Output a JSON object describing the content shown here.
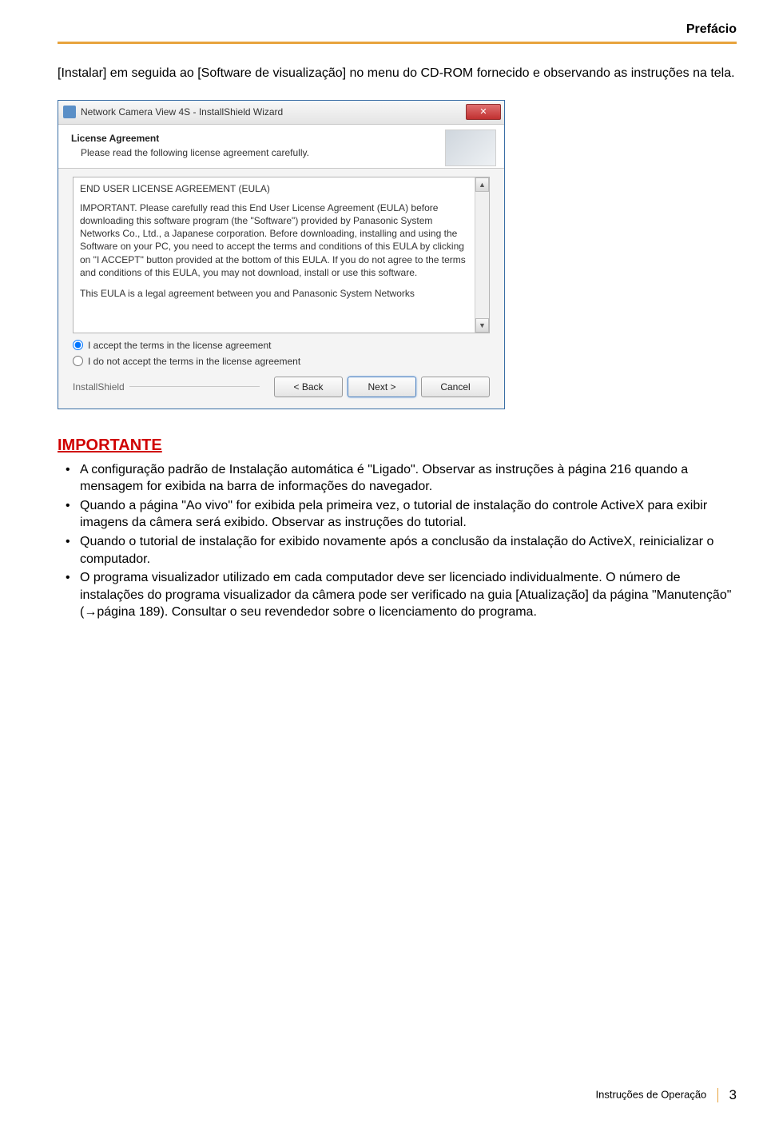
{
  "header": {
    "label": "Prefácio"
  },
  "intro": "[Instalar] em seguida ao [Software de visualização] no menu do CD-ROM fornecido e observando as instruções na tela.",
  "installer": {
    "title": "Network Camera View 4S - InstallShield Wizard",
    "close_glyph": "✕",
    "banner_title": "License Agreement",
    "banner_sub": "Please read the following license agreement carefully.",
    "eula_heading": "END USER LICENSE AGREEMENT (EULA)",
    "eula_p1": "IMPORTANT.  Please carefully read this End User License Agreement (EULA) before downloading this software program (the \"Software\") provided by Panasonic System Networks Co., Ltd., a Japanese corporation.  Before downloading, installing and using the Software on your PC, you need to accept the terms and conditions of this EULA by clicking on \"I ACCEPT\" button provided at the bottom of this EULA.  If you do not agree to the terms and conditions of this EULA, you may not download, install or use this software.",
    "eula_p2": "This EULA is a legal agreement between you and Panasonic System Networks",
    "radio_accept": "I accept the terms in the license agreement",
    "radio_reject": "I do not accept the terms in the license agreement",
    "installshield_label": "InstallShield",
    "btn_back": "< Back",
    "btn_next": "Next >",
    "btn_cancel": "Cancel",
    "scroll_up": "▲",
    "scroll_down": "▼"
  },
  "important": {
    "title": "IMPORTANTE",
    "items": [
      "A configuração padrão de Instalação automática é \"Ligado\". Observar as instruções à página 216 quando a mensagem for exibida na barra de informações do navegador.",
      "Quando a página \"Ao vivo\" for exibida pela primeira vez, o tutorial de instalação do controle ActiveX para exibir imagens da câmera será exibido. Observar as instruções do tutorial.",
      "Quando o tutorial de instalação for exibido novamente após a conclusão da instalação do ActiveX, reinicializar o computador.",
      "O programa visualizador utilizado em cada computador deve ser licenciado individualmente. O número de instalações do programa visualizador da câmera pode ser verificado na guia [Atualização] da página \"Manutenção\" (→página 189). Consultar o seu revendedor sobre o licenciamento do programa."
    ]
  },
  "footer": {
    "doc_label": "Instruções de Operação",
    "page_number": "3"
  }
}
